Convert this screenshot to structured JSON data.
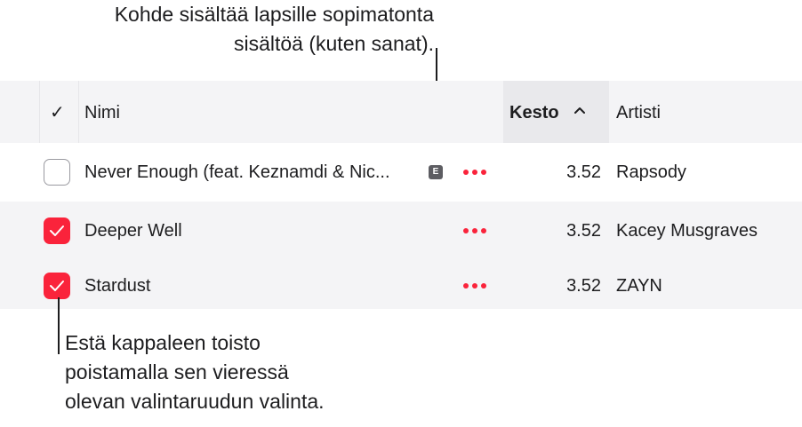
{
  "callouts": {
    "top_line1": "Kohde sisältää lapsille sopimatonta",
    "top_line2": "sisältöä (kuten sanat).",
    "bottom_line1": "Estä kappaleen toisto",
    "bottom_line2": "poistamalla sen vieressä",
    "bottom_line3": "olevan valintaruudun valinta."
  },
  "table": {
    "headers": {
      "check": "✓",
      "name": "Nimi",
      "time": "Kesto",
      "sort_indicator": "^",
      "artist": "Artisti"
    },
    "rows": [
      {
        "checked": false,
        "name": "Never Enough (feat. Keznamdi & Nic...",
        "explicit": "E",
        "time": "3.52",
        "artist": "Rapsody"
      },
      {
        "checked": true,
        "name": "Deeper Well",
        "explicit": "",
        "time": "3.52",
        "artist": "Kacey Musgraves"
      },
      {
        "checked": true,
        "name": "Stardust",
        "explicit": "",
        "time": "3.52",
        "artist": "ZAYN"
      }
    ]
  },
  "colors": {
    "accent": "#fa233b",
    "header_bg": "#f4f4f6",
    "sorted_column_bg": "#e9e9ec",
    "explicit_badge": "#5d5d62"
  },
  "icons": {
    "checkmark": "checkmark-icon",
    "more": "ellipsis-icon",
    "explicit": "explicit-icon",
    "sort": "chevron-up-icon"
  }
}
